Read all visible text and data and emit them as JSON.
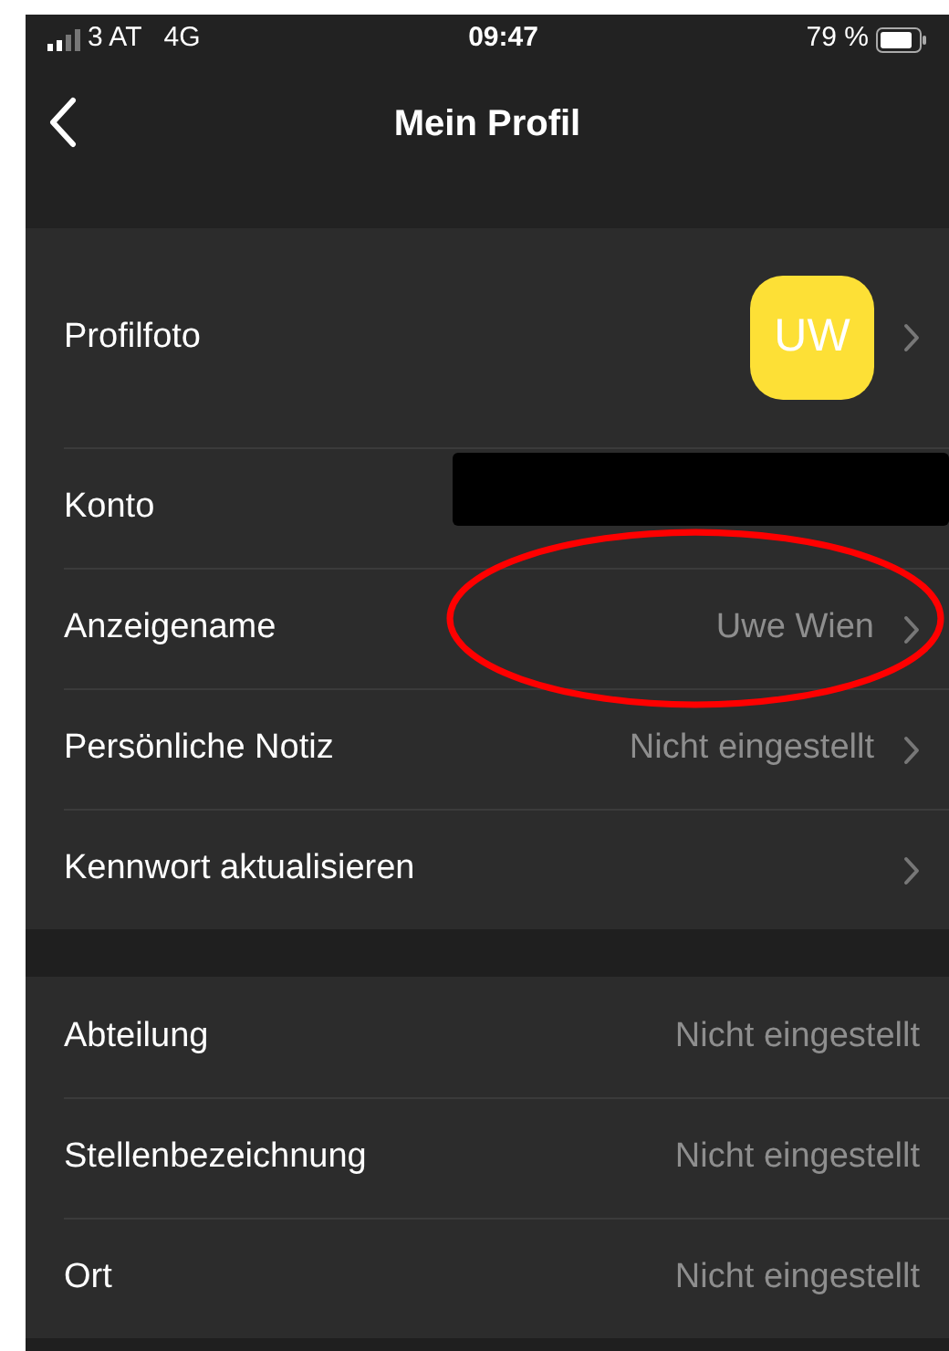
{
  "status_bar": {
    "carrier": "3 AT",
    "network": "4G",
    "time": "09:47",
    "battery": "79 %"
  },
  "nav_bar": {
    "title": "Mein Profil"
  },
  "sections": [
    {
      "rows": [
        {
          "kind": "avatar",
          "label": "Profilfoto",
          "avatar_initials": "UW",
          "chevron": true
        },
        {
          "kind": "redacted",
          "label": "Konto",
          "chevron": false
        },
        {
          "kind": "value",
          "label": "Anzeigename",
          "value": "Uwe Wien",
          "chevron": true
        },
        {
          "kind": "value",
          "label": "Persönliche Notiz",
          "value": "Nicht eingestellt",
          "chevron": true
        },
        {
          "kind": "value",
          "label": "Kennwort aktualisieren",
          "chevron": true
        }
      ]
    },
    {
      "rows": [
        {
          "kind": "value",
          "label": "Abteilung",
          "value": "Nicht eingestellt",
          "chevron": false
        },
        {
          "kind": "value",
          "label": "Stellenbezeichnung",
          "value": "Nicht eingestellt",
          "chevron": false
        },
        {
          "kind": "value",
          "label": "Ort",
          "value": "Nicht eingestellt",
          "chevron": false
        }
      ]
    }
  ]
}
